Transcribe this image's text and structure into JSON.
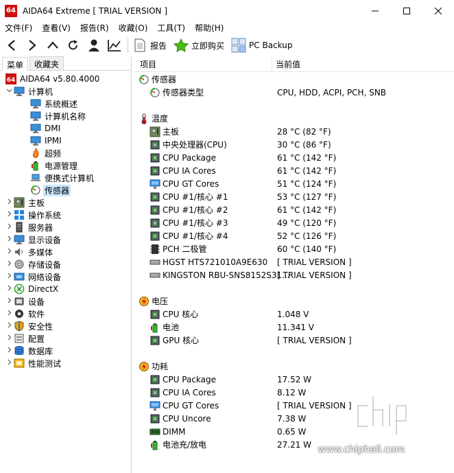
{
  "window": {
    "title": "AIDA64 Extreme  [ TRIAL VERSION ]",
    "app_icon_text": "64",
    "controls": [
      "minimize",
      "maximize",
      "close"
    ]
  },
  "menu": [
    "文件(F)",
    "查看(V)",
    "报告(R)",
    "收藏(O)",
    "工具(T)",
    "帮助(H)"
  ],
  "toolbar": {
    "nav_icons": [
      "back-icon",
      "forward-icon",
      "up-icon",
      "refresh-icon",
      "user-icon",
      "chart-icon"
    ],
    "report_label": "报告",
    "buy_label": "立即购买",
    "backup_label": "PC Backup"
  },
  "left_tabs": [
    "菜单",
    "收藏夹"
  ],
  "tree": [
    {
      "label": "AIDA64 v5.80.4000",
      "level": 0,
      "chev": "",
      "icon": "aida-icon"
    },
    {
      "label": "计算机",
      "level": 0,
      "chev": "v",
      "icon": "computer-icon"
    },
    {
      "label": "系统概述",
      "level": 2,
      "chev": "",
      "icon": "monitor-icon"
    },
    {
      "label": "计算机名称",
      "level": 2,
      "chev": "",
      "icon": "monitor-icon"
    },
    {
      "label": "DMI",
      "level": 2,
      "chev": "",
      "icon": "monitor-icon"
    },
    {
      "label": "IPMI",
      "level": 2,
      "chev": "",
      "icon": "monitor-icon"
    },
    {
      "label": "超频",
      "level": 2,
      "chev": "",
      "icon": "flame-icon"
    },
    {
      "label": "电源管理",
      "level": 2,
      "chev": "",
      "icon": "power-icon"
    },
    {
      "label": "便携式计算机",
      "level": 2,
      "chev": "",
      "icon": "laptop-icon"
    },
    {
      "label": "传感器",
      "level": 2,
      "chev": "",
      "icon": "sensor-icon",
      "selected": true
    },
    {
      "label": "主板",
      "level": 0,
      "chev": ">",
      "icon": "motherboard-icon"
    },
    {
      "label": "操作系统",
      "level": 0,
      "chev": ">",
      "icon": "windows-icon"
    },
    {
      "label": "服务器",
      "level": 0,
      "chev": ">",
      "icon": "server-icon"
    },
    {
      "label": "显示设备",
      "level": 0,
      "chev": ">",
      "icon": "display-icon"
    },
    {
      "label": "多媒体",
      "level": 0,
      "chev": ">",
      "icon": "speaker-icon"
    },
    {
      "label": "存储设备",
      "level": 0,
      "chev": ">",
      "icon": "disk-icon"
    },
    {
      "label": "网络设备",
      "level": 0,
      "chev": ">",
      "icon": "network-icon"
    },
    {
      "label": "DirectX",
      "level": 0,
      "chev": ">",
      "icon": "xbox-icon"
    },
    {
      "label": "设备",
      "level": 0,
      "chev": ">",
      "icon": "device-icon"
    },
    {
      "label": "软件",
      "level": 0,
      "chev": ">",
      "icon": "software-icon"
    },
    {
      "label": "安全性",
      "level": 0,
      "chev": ">",
      "icon": "shield-icon"
    },
    {
      "label": "配置",
      "level": 0,
      "chev": ">",
      "icon": "config-icon"
    },
    {
      "label": "数据库",
      "level": 0,
      "chev": ">",
      "icon": "database-icon"
    },
    {
      "label": "性能测试",
      "level": 0,
      "chev": ">",
      "icon": "benchmark-icon"
    }
  ],
  "columns": {
    "field": "项目",
    "value": "当前值"
  },
  "sections": [
    {
      "title": "传感器",
      "icon": "sensor-icon",
      "rows": [
        {
          "name": "传感器类型",
          "value": "CPU, HDD, ACPI, PCH, SNB",
          "icon": "sensor-icon"
        }
      ]
    },
    {
      "title": "温度",
      "icon": "thermometer-icon",
      "rows": [
        {
          "name": "主板",
          "value": "28 °C  (82 °F)",
          "icon": "motherboard-icon"
        },
        {
          "name": "中央处理器(CPU)",
          "value": "30 °C  (86 °F)",
          "icon": "cpu-icon"
        },
        {
          "name": "CPU Package",
          "value": "61 °C  (142 °F)",
          "icon": "cpu-icon"
        },
        {
          "name": "CPU IA Cores",
          "value": "61 °C  (142 °F)",
          "icon": "cpu-icon"
        },
        {
          "name": "CPU GT Cores",
          "value": "51 °C  (124 °F)",
          "icon": "gpu-icon"
        },
        {
          "name": "CPU #1/核心 #1",
          "value": "53 °C  (127 °F)",
          "icon": "cpu-icon"
        },
        {
          "name": "CPU #1/核心 #2",
          "value": "61 °C  (142 °F)",
          "icon": "cpu-icon"
        },
        {
          "name": "CPU #1/核心 #3",
          "value": "49 °C  (120 °F)",
          "icon": "cpu-icon"
        },
        {
          "name": "CPU #1/核心 #4",
          "value": "52 °C  (126 °F)",
          "icon": "cpu-icon"
        },
        {
          "name": "PCH 二极管",
          "value": "60 °C  (140 °F)",
          "icon": "chip-icon"
        },
        {
          "name": "HGST HTS721010A9E630",
          "value": "[ TRIAL VERSION ]",
          "icon": "hdd-icon"
        },
        {
          "name": "KINGSTON RBU-SNS8152S31...",
          "value": "[ TRIAL VERSION ]",
          "icon": "hdd-icon"
        }
      ]
    },
    {
      "title": "电压",
      "icon": "voltage-icon",
      "rows": [
        {
          "name": "CPU 核心",
          "value": "1.048 V",
          "icon": "cpu-icon"
        },
        {
          "name": "电池",
          "value": "11.341 V",
          "icon": "battery-icon"
        },
        {
          "name": "GPU 核心",
          "value": "[ TRIAL VERSION ]",
          "icon": "cpu-icon"
        }
      ]
    },
    {
      "title": "功耗",
      "icon": "voltage-icon",
      "rows": [
        {
          "name": "CPU Package",
          "value": "17.52 W",
          "icon": "cpu-icon"
        },
        {
          "name": "CPU IA Cores",
          "value": "8.12 W",
          "icon": "cpu-icon"
        },
        {
          "name": "CPU GT Cores",
          "value": "[ TRIAL VERSION ]",
          "icon": "gpu-icon"
        },
        {
          "name": "CPU Uncore",
          "value": "7.38 W",
          "icon": "cpu-icon"
        },
        {
          "name": "DIMM",
          "value": "0.65 W",
          "icon": "ram-icon"
        },
        {
          "name": "电池充/放电",
          "value": "27.21 W",
          "icon": "battery-icon"
        }
      ]
    }
  ],
  "watermark": {
    "text": "chip hell",
    "url": "www.chiphell.com"
  }
}
